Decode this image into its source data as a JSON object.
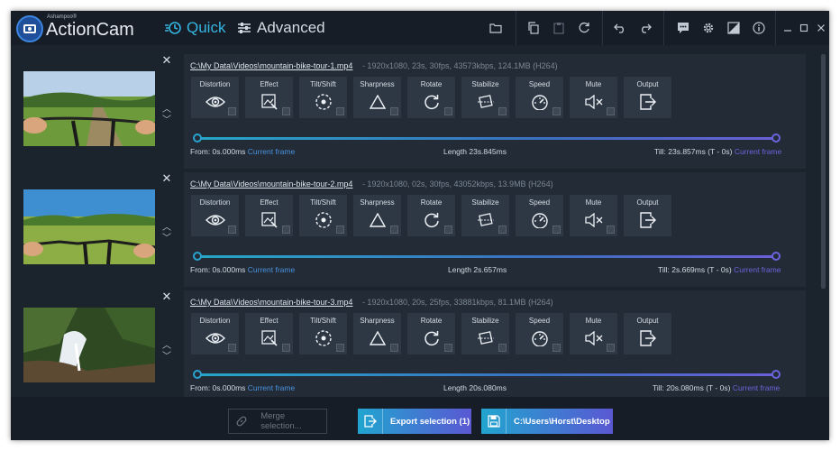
{
  "app": {
    "vendor": "Ashampoo®",
    "name": "ActionCam"
  },
  "modes": {
    "quick": "Quick",
    "advanced": "Advanced"
  },
  "colors": {
    "accent": "#35b6e3",
    "gradient_start": "#21a5cf",
    "gradient_end": "#5a58d3"
  },
  "effect_labels": [
    "Distortion",
    "Effect",
    "Tilt/Shift",
    "Sharpness",
    "Rotate",
    "Stabilize",
    "Speed",
    "Mute",
    "Output"
  ],
  "rows": [
    {
      "path": "C:\\My Data\\Videos\\mountain-bike-tour-1.mp4",
      "meta": "-   1920x1080, 23s, 30fps, 43573kbps, 124.1MB (H264)",
      "from": "From: 0s.000ms",
      "current_frame": "Current frame",
      "length": "Length  23s.845ms",
      "till": "Till:  23s.857ms (T - 0s)",
      "current_frame_end": "Current frame"
    },
    {
      "path": "C:\\My Data\\Videos\\mountain-bike-tour-2.mp4",
      "meta": "-   1920x1080, 02s, 30fps, 43052kbps, 13.9MB (H264)",
      "from": "From: 0s.000ms",
      "current_frame": "Current frame",
      "length": "Length  2s.657ms",
      "till": "Till:  2s.669ms (T - 0s)",
      "current_frame_end": "Current frame"
    },
    {
      "path": "C:\\My Data\\Videos\\mountain-bike-tour-3.mp4",
      "meta": "-   1920x1080, 20s, 25fps, 33881kbps, 81.1MB (H264)",
      "from": "From: 0s.000ms",
      "current_frame": "Current frame",
      "length": "Length  20s.080ms",
      "till": "Till:  20s.080ms (T - 0s)",
      "current_frame_end": "Current frame"
    }
  ],
  "bottom": {
    "merge": "Merge selection...",
    "export": "Export selection (1)",
    "folder": "C:\\Users\\Horst\\Desktop"
  }
}
